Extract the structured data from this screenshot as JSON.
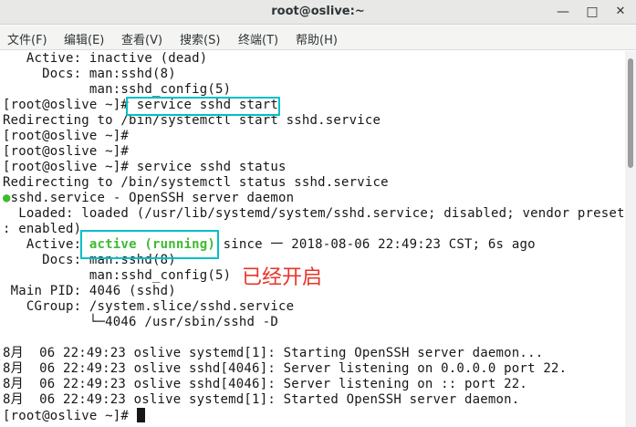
{
  "window": {
    "title": "root@oslive:~",
    "minimize_glyph": "—",
    "maximize_glyph": "□",
    "close_glyph": "✕"
  },
  "menu": [
    {
      "label": "文件(F)"
    },
    {
      "label": "编辑(E)"
    },
    {
      "label": "查看(V)"
    },
    {
      "label": "搜索(S)"
    },
    {
      "label": "终端(T)"
    },
    {
      "label": "帮助(H)"
    }
  ],
  "terminal": {
    "lines": [
      "   Active: inactive (dead)",
      "     Docs: man:sshd(8)",
      "           man:sshd_config(5)",
      "[root@oslive ~]# ",
      "Redirecting to /bin/systemctl start sshd.service",
      "[root@oslive ~]#",
      "[root@oslive ~]#",
      "[root@oslive ~]# service sshd status",
      "Redirecting to /bin/systemctl status sshd.service",
      "",
      "  Loaded: loaded (/usr/lib/systemd/system/sshd.service; disabled; vendor preset",
      ": enabled)",
      "",
      "     Docs: man:sshd(8)",
      "           man:sshd_config(5)",
      " Main PID: 4046 (sshd)",
      "   CGroup: /system.slice/sshd.service",
      "           └─4046 /usr/sbin/sshd -D",
      "",
      "8月  06 22:49:23 oslive systemd[1]: Starting OpenSSH server daemon...",
      "8月  06 22:49:23 oslive sshd[4046]: Server listening on 0.0.0.0 port 22.",
      "8月  06 22:49:23 oslive sshd[4046]: Server listening on :: port 22.",
      "8月  06 22:49:23 oslive systemd[1]: Started OpenSSH server daemon.",
      "[root@oslive ~]# "
    ],
    "start_command": "service sshd start",
    "service_line": {
      "dot": "●",
      "text": "sshd.service - OpenSSH server daemon"
    },
    "active_line": {
      "prefix": "   Active: ",
      "status": "active (running)",
      "suffix": " since 一 2018-08-06 22:49:23 CST; 6s ago"
    }
  },
  "annotation": "已经开启",
  "colors": {
    "highlight_box": "#00bfc8",
    "annotation": "#e8332a",
    "running_status": "#3dbb2e"
  }
}
